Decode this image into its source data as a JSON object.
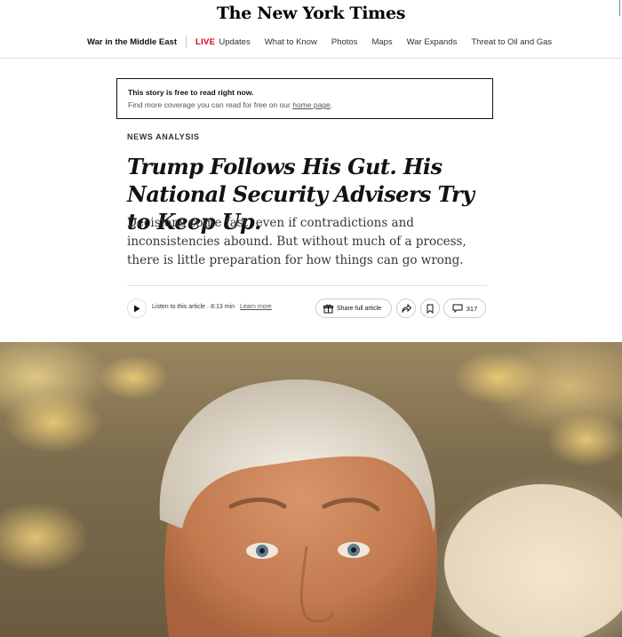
{
  "masthead": {
    "logo": "The New York Times"
  },
  "nav": {
    "section": "War in the Middle East",
    "live_label": "LIVE",
    "items": [
      "Updates",
      "What to Know",
      "Photos",
      "Maps",
      "War Expands",
      "Threat to Oil and Gas"
    ]
  },
  "free_box": {
    "title": "This story is free to read right now.",
    "subtitle_prefix": "Find more coverage you can read for free on our ",
    "link": "home page",
    "subtitle_suffix": "."
  },
  "article": {
    "kicker": "NEWS ANALYSIS",
    "headline": "Trump Follows His Gut. His National Security Advisers Try to Keep Up.",
    "summary": "Decisions come fast, even if contradictions and inconsistencies abound. But without much of a process, there is little preparation for how things can go wrong."
  },
  "toolbar": {
    "listen_text": "Listen to this article · 8:13 min",
    "learn_more": "Learn more",
    "share_label": "Share full article",
    "comment_count": "317"
  },
  "icons": [
    "play-icon",
    "gift-icon",
    "share-arrow-icon",
    "bookmark-icon",
    "comment-icon"
  ]
}
